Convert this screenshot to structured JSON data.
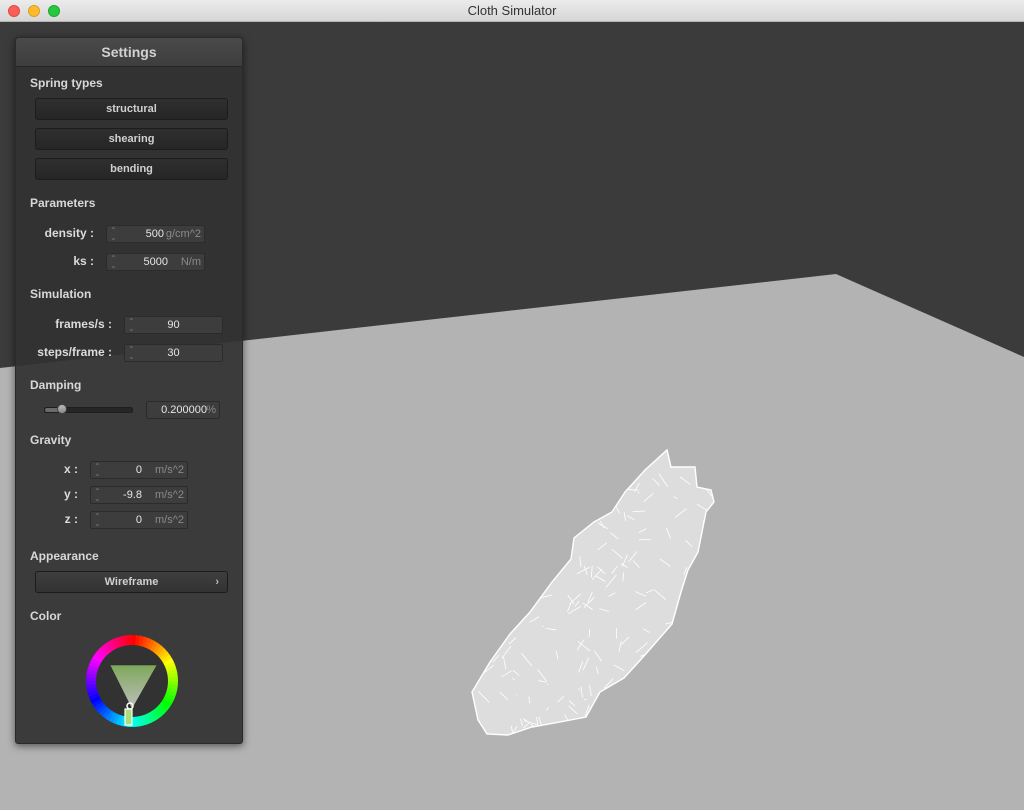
{
  "window": {
    "title": "Cloth Simulator"
  },
  "settings": {
    "title": "Settings",
    "spring_types": {
      "heading": "Spring types",
      "buttons": [
        "structural",
        "shearing",
        "bending"
      ]
    },
    "parameters": {
      "heading": "Parameters",
      "density": {
        "label": "density :",
        "value": "500",
        "unit": "g/cm^2"
      },
      "ks": {
        "label": "ks :",
        "value": "5000",
        "unit": "N/m"
      }
    },
    "simulation": {
      "heading": "Simulation",
      "fps": {
        "label": "frames/s :",
        "value": "90"
      },
      "steps": {
        "label": "steps/frame :",
        "value": "30"
      }
    },
    "damping": {
      "heading": "Damping",
      "value": "0.200000",
      "unit": "%",
      "slider_fraction": 0.2
    },
    "gravity": {
      "heading": "Gravity",
      "x": {
        "label": "x :",
        "value": "0",
        "unit": "m/s^2"
      },
      "y": {
        "label": "y :",
        "value": "-9.8",
        "unit": "m/s^2"
      },
      "z": {
        "label": "z :",
        "value": "0",
        "unit": "m/s^2"
      }
    },
    "appearance": {
      "heading": "Appearance",
      "selected": "Wireframe"
    },
    "color": {
      "heading": "Color",
      "selected_hex": "#a8e078"
    }
  },
  "scene": {
    "background_hex": "#3b3b3b",
    "ground_hex": "#b3b3b3",
    "cloth_hex": "#ffffff"
  }
}
